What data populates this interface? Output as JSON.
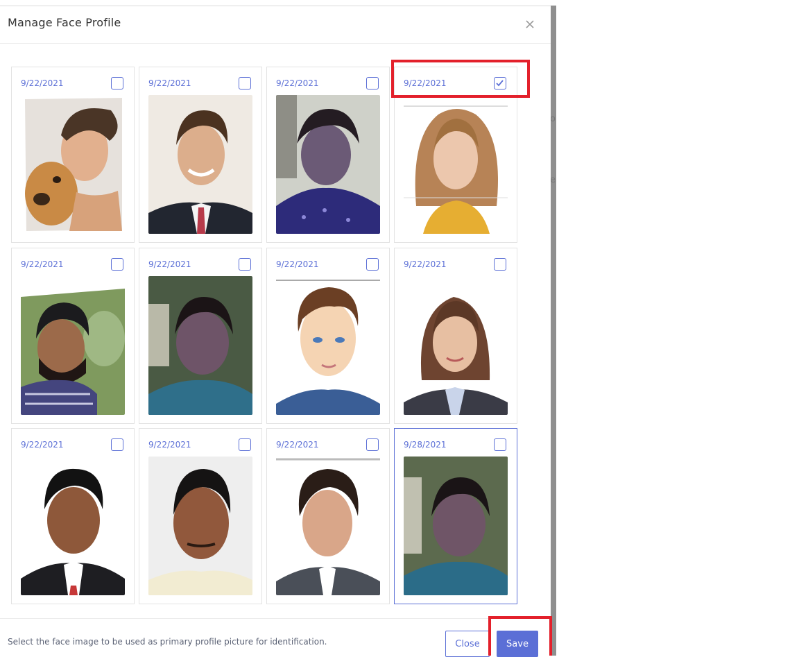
{
  "modal": {
    "title": "Manage Face Profile",
    "footer_text": "Select the face image to be used as primary profile picture for identification.",
    "close_label": "Close",
    "save_label": "Save"
  },
  "background_fragments": [
    "o",
    "e"
  ],
  "faces": [
    {
      "date": "9/22/2021",
      "checked": false,
      "photo": "man-with-dog-photo"
    },
    {
      "date": "9/22/2021",
      "checked": false,
      "photo": "stock-man-suit-photo"
    },
    {
      "date": "9/22/2021",
      "checked": false,
      "photo": "woman-webcam-photo"
    },
    {
      "date": "9/22/2021",
      "checked": true,
      "photo": "woman-portrait-photo"
    },
    {
      "date": "9/22/2021",
      "checked": false,
      "photo": "bearded-man-outdoor-photo"
    },
    {
      "date": "9/22/2021",
      "checked": false,
      "photo": "woman-webcam-photo-2"
    },
    {
      "date": "9/22/2021",
      "checked": false,
      "photo": "cartoon-man-photo"
    },
    {
      "date": "9/22/2021",
      "checked": false,
      "photo": "woman-business-photo"
    },
    {
      "date": "9/22/2021",
      "checked": false,
      "photo": "young-man-passport-photo"
    },
    {
      "date": "9/22/2021",
      "checked": false,
      "photo": "older-man-passport-photo"
    },
    {
      "date": "9/22/2021",
      "checked": false,
      "photo": "man-suit-portrait-photo"
    },
    {
      "date": "9/28/2021",
      "checked": false,
      "photo": "woman-webcam-photo-3"
    }
  ],
  "colors": {
    "accent": "#5b6fd6",
    "highlight": "#e3202b"
  }
}
